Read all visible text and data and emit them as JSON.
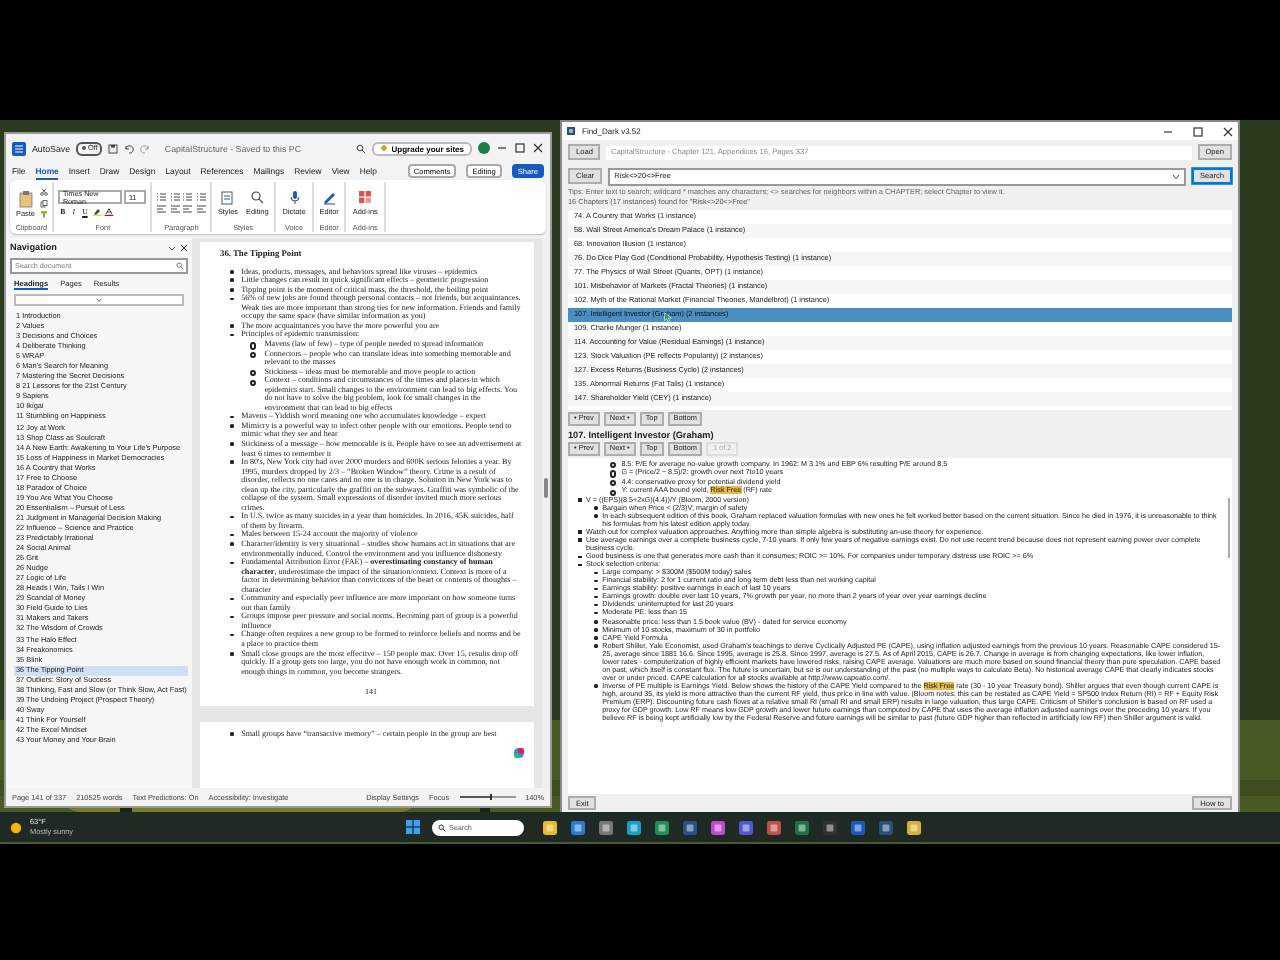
{
  "word": {
    "title": "CapitalStructure - Saved to this PC",
    "autosave": {
      "label": "AutoSave",
      "on": false,
      "state_text": "Off"
    },
    "upgrade": "Upgrade your sites",
    "menu_tabs": [
      {
        "label": "File",
        "selected": false
      },
      {
        "label": "Home",
        "selected": true
      },
      {
        "label": "Insert",
        "selected": false
      },
      {
        "label": "Draw",
        "selected": false
      },
      {
        "label": "Design",
        "selected": false
      },
      {
        "label": "Layout",
        "selected": false
      },
      {
        "label": "References",
        "selected": false
      },
      {
        "label": "Mailings",
        "selected": false
      },
      {
        "label": "Review",
        "selected": false
      },
      {
        "label": "View",
        "selected": false
      },
      {
        "label": "Help",
        "selected": false
      }
    ],
    "actions": [
      {
        "label": "Comments",
        "kind": "plain"
      },
      {
        "label": "Editing",
        "kind": "dropdown"
      },
      {
        "label": "Share",
        "kind": "primary"
      }
    ],
    "ribbon": [
      {
        "label": "Clipboard",
        "kind": "clipboard",
        "buttons": [
          "Paste"
        ]
      },
      {
        "label": "Font",
        "kind": "font",
        "font": "Times New Roman",
        "size": "11",
        "format": [
          "B",
          "I",
          "U"
        ]
      },
      {
        "label": "Paragraph",
        "kind": "paragraph"
      },
      {
        "label": "Styles",
        "kind": "big",
        "buttons": [
          "Styles",
          "Editing"
        ]
      },
      {
        "label": "Voice",
        "kind": "big",
        "buttons": [
          "Dictate"
        ]
      },
      {
        "label": "Editor",
        "kind": "big",
        "buttons": [
          "Editor"
        ]
      },
      {
        "label": "Add-ins",
        "kind": "big",
        "buttons": [
          "Add-ins"
        ]
      }
    ],
    "navigation": {
      "title": "Navigation",
      "placeholder": "Search document",
      "tabs": [
        {
          "label": "Headings",
          "selected": true
        },
        {
          "label": "Pages",
          "selected": false
        },
        {
          "label": "Results",
          "selected": false
        }
      ],
      "headings": [
        {
          "label": "1 Introduction",
          "selected": false
        },
        {
          "label": "2 Values",
          "selected": false
        },
        {
          "label": "3 Decisions and Choices",
          "selected": false
        },
        {
          "label": "4 Deliberate Thinking",
          "selected": false
        },
        {
          "label": "5 WRAP",
          "selected": false
        },
        {
          "label": "6 Man's Search for Meaning",
          "selected": false
        },
        {
          "label": "7 Mastering the Secret Decisions",
          "selected": false
        },
        {
          "label": "8 21 Lessons for the 21st Century",
          "selected": false
        },
        {
          "label": "9 Sapiens",
          "selected": false
        },
        {
          "label": "10 Ikigai",
          "selected": false
        },
        {
          "label": "11 Stumbling on Happiness",
          "selected": false
        },
        {
          "label": "12 Joy at Work",
          "selected": false
        },
        {
          "label": "13 Shop Class as Soulcraft",
          "selected": false
        },
        {
          "label": "14 A New Earth: Awakening to Your Life's Purpose",
          "selected": false
        },
        {
          "label": "15 Loss of Happiness in Market Democracies",
          "selected": false
        },
        {
          "label": "16 A Country that Works",
          "selected": false
        },
        {
          "label": "17 Free to Choose",
          "selected": false
        },
        {
          "label": "18 Paradox of Choice",
          "selected": false
        },
        {
          "label": "19 You Are What You Choose",
          "selected": false
        },
        {
          "label": "20 Essentialism – Pursuit of Less",
          "selected": false
        },
        {
          "label": "21 Judgment in Managerial Decision Making",
          "selected": false
        },
        {
          "label": "22 Influence – Science and Practice",
          "selected": false
        },
        {
          "label": "23 Predictably Irrational",
          "selected": false
        },
        {
          "label": "24 Social Animal",
          "selected": false
        },
        {
          "label": "25 Grit",
          "selected": false
        },
        {
          "label": "26 Nudge",
          "selected": false
        },
        {
          "label": "27 Logic of Life",
          "selected": false
        },
        {
          "label": "28 Heads I Win, Tails I Win",
          "selected": false
        },
        {
          "label": "29 Scandal of Money",
          "selected": false
        },
        {
          "label": "30 Field Guide to Lies",
          "selected": false
        },
        {
          "label": "31 Makers and Takers",
          "selected": false
        },
        {
          "label": "32 The Wisdom of Crowds",
          "selected": false
        },
        {
          "label": "33 The Halo Effect",
          "selected": false
        },
        {
          "label": "34 Freakonomics",
          "selected": false
        },
        {
          "label": "35 Blink",
          "selected": false
        },
        {
          "label": "36 The Tipping Point",
          "selected": true
        },
        {
          "label": "37 Outliers: Story of Success",
          "selected": false
        },
        {
          "label": "38 Thinking, Fast and Slow (or Think Slow, Act Fast)",
          "selected": false
        },
        {
          "label": "39 The Undoing Project (Prospect Theory)",
          "selected": false
        },
        {
          "label": "40 Sway",
          "selected": false
        },
        {
          "label": "41 Think For Yourself",
          "selected": false
        },
        {
          "label": "42 The Excel Mindset",
          "selected": false
        },
        {
          "label": "43 Your Money and Your Brain",
          "selected": false
        }
      ]
    },
    "document": {
      "heading": "36. The Tipping Point",
      "bullets": [
        {
          "text": "Ideas, products, messages, and behaviors spread like viruses – epidemics"
        },
        {
          "text": "Little changes can result in quick significant effects – geometric progression"
        },
        {
          "text": "Tipping point is the moment of critical mass, the threshold, the boiling point"
        },
        {
          "text": "56% of new jobs are found through personal contacts – not friends, but acquaintances.  Weak ties are more important than strong ties for new information.  Friends and family occupy the same space (have similar information as you)"
        },
        {
          "text": "The more acquaintances you have the more powerful you are"
        },
        {
          "text": "Principles of epidemic transmission:",
          "children": [
            {
              "text": "Mavens (law of few) – type of people needed to spread information"
            },
            {
              "text": "Connectors – people who can translate ideas into something memorable and relevant to the masses"
            },
            {
              "text": "Stickiness – ideas must be memorable and move people to action"
            },
            {
              "text": "Context – conditions and circumstances of the times and places in which epidemics start.  Small changes to the environment can lead to big effects.  You do not have to solve the big problem, look for small changes in the environment that can lead to big effects"
            }
          ]
        },
        {
          "text": "Mavens – Yiddish word meaning one who accumulates knowledge – expert"
        },
        {
          "text": "Mimicry is a powerful way to infect other people with our emotions.  People tend to mimic what they see and hear"
        },
        {
          "text": "Stickiness of a message – how memorable is it.  People have to see an advertisement at least 6 times to remember it"
        },
        {
          "text": "In 80's, New York city had over 2000 murders and 600K serious felonies a year.  By 1995, murders dropped by 2/3 – “Broken Window” theory.  Crime is a result of disorder, reflects no one cares and no one is in charge.  Solution in New York was to clean up the city, particularly the graffiti on the subways.  Graffiti was symbolic of the collapse of the system.  Small expressions of disorder invited much more serious crimes."
        },
        {
          "text": "In U.S. twice as many suicides in a year than homicides.  In 2016, 45K suicides, half of them by firearm."
        },
        {
          "text": "Males between 15-24 account the majority of violence"
        },
        {
          "text": "Character/identity is very situational – studies show humans act in situations that are environmentally induced.  Control the environment and you influence dishonesty"
        },
        {
          "text": "Fundamental Attribution Error (FAE) – **overestimating constancy of human character**, underestimate the impact of the situation/context.  Context is more of a factor in determining behavior than convictions of the heart or contents of thoughts – character"
        },
        {
          "text": "Community and especially peer influence are more important on how someone turns out than family"
        },
        {
          "text": "Groups impose peer pressure and social norms.  Becoming part of group is a powerful influence"
        },
        {
          "text": "Change often requires a new group to be formed to reinforce beliefs and norms and be a place to practice them"
        },
        {
          "text": "Small close groups are the most effective – 150 people max.  Over 15, results drop off quickly.  If a group gets too large, you do not have enough work in common, not enough things in common, you become strangers."
        }
      ],
      "page_number": "141",
      "next_page": [
        {
          "text": "Small groups have “transactive memory” – certain people in the group are best"
        }
      ]
    },
    "status_bar": [
      {
        "label": "Page 141 of 337",
        "kind": "text"
      },
      {
        "label": "210525 words",
        "kind": "text"
      },
      {
        "label": "Text Predictions: On",
        "kind": "text"
      },
      {
        "label": "Accessibility: Investigate",
        "kind": "text"
      },
      {
        "label": "Display Settings",
        "kind": "right"
      },
      {
        "label": "Focus",
        "kind": "right"
      },
      {
        "label": "140%",
        "kind": "zoom",
        "level": 0.55
      }
    ]
  },
  "find_dark": {
    "title": "Find_Dark v3.52",
    "load": "Load",
    "path": "CapitalStructure - Chapter 121, Appendices 16, Pages 337",
    "open": "Open",
    "clear": "Clear",
    "query": "Risk<>20<>Free",
    "search": "Search",
    "hint": "Tips: Enter text to search; wildcard * matches any characters; <> searches for neighbors within a CHAPTER; select Chapter to view it.",
    "count": "16 Chapters (17 instances) found for \"Risk<>20<>Free\"",
    "results": [
      {
        "label": "74. A Country that Works  (1 instance)",
        "selected": false
      },
      {
        "label": "58. Wall Street America's Dream Palace  (1 instance)",
        "selected": false
      },
      {
        "label": "68. Innovation Illusion  (1 instance)",
        "selected": false
      },
      {
        "label": "76. Do Dice Play God (Conditional Probability, Hypothesis Testing)  (1 instance)",
        "selected": false
      },
      {
        "label": "77. The Physics of Wall Street (Quants, OPT)  (1 instance)",
        "selected": false
      },
      {
        "label": "101. Misbehavior of Markets (Fractal Theories)  (1 instance)",
        "selected": false
      },
      {
        "label": "102. Myth of the Rational Market (Financial Theories, Mandelbrot)  (1 instance)",
        "selected": false
      },
      {
        "label": "107. Intelligent Investor (Graham)  (2 instances)",
        "selected": true
      },
      {
        "label": "109. Charlie Munger  (1 instance)",
        "selected": false
      },
      {
        "label": "114. Accounting for Value (Residual Earnings)  (1 instance)",
        "selected": false
      },
      {
        "label": "123. Stock Valuation (PE reflects Popularity)  (2 instances)",
        "selected": false
      },
      {
        "label": "127. Excess Returns (Business Cycle)  (2 instances)",
        "selected": false
      },
      {
        "label": "135. Abnormal Returns (Fat Tails)  (1 instance)",
        "selected": false
      },
      {
        "label": "147. Shareholder Yield (CEY)  (1 instance)",
        "selected": false
      }
    ],
    "nav_buttons": [
      "• Prev",
      "Next •",
      "Top",
      "Bottom"
    ],
    "chapter_title": "107.  Intelligent Investor (Graham)",
    "match_buttons": [
      {
        "label": "• Prev",
        "disabled": false
      },
      {
        "label": "Next •",
        "disabled": false
      },
      {
        "label": "Top",
        "disabled": false
      },
      {
        "label": "Bottom",
        "disabled": false
      },
      {
        "label": "1 of 2",
        "disabled": true
      }
    ],
    "detail": [
      {
        "children": [
          {
            "children": [
              {
                "text": "8.5: P/E for average no-value growth company. In 1962: M 3.1% and EBP 6% resulting P/E around 8.5"
              },
              {
                "text": "G = (Price/2 − 8.5)/2: growth over next 7to10 years"
              },
              {
                "text": "4.4: conservative proxy for potential dividend yield"
              },
              {
                "parts": [
                  {
                    "text": "Y: current AAA bound yield, "
                  },
                  {
                    "text": "Risk Free",
                    "highlight": true
                  },
                  {
                    "text": " (RF) rate"
                  }
                ]
              }
            ]
          }
        ]
      },
      {
        "text": "V = ((EPS)(8.5+2xG)(4.4))/Y  (Bloom, 2000 version)",
        "children": [
          {
            "text": "Bargain when Price < (2/3)V; margin of safety"
          },
          {
            "text": "In each subsequent edition of this book, Graham replaced valuation formulas with new ones he felt worked better based on the current situation. Since he died in 1976, it is unreasonable to think his formulas from his latest edition apply today."
          }
        ]
      },
      {
        "text": "Watch out for complex valuation approaches. Anything more than simple algebra is substituting an-use theory for experience."
      },
      {
        "text": "Use average earnings over a complete business cycle, 7-10 years. If only few years of negative earnings exist. Do not use recent trend because does not represent earning power over complete business cycle."
      },
      {
        "text": "Good business is one that generates more cash than it consumes; ROIC >= 10%. For companies under temporary distress use ROIC >= 6%"
      },
      {
        "text": "Stock selection criteria:",
        "children": [
          {
            "text": "Large company: > $300M ($500M today) sales"
          },
          {
            "text": "Financial stability: 2 for 1 current ratio and long term debt less than net working capital"
          },
          {
            "text": "Earnings stability: positive earnings in each of last 10 years"
          },
          {
            "text": "Earnings growth: double over last 10 years, 7% growth per year, no more than 2 years of year over year earnings decline"
          },
          {
            "text": "Dividends: uninterrupted for last 20 years"
          },
          {
            "text": "Moderate PE: less than 15"
          },
          {
            "text": "Reasonable price: less than 1.5 book value (BV) - dated for service economy"
          },
          {
            "text": "Minimum of 10 stocks, maximum of 30 in portfolio"
          },
          {
            "text": "CAPE Yield Formula"
          },
          {
            "text": "Robert Shiller, Yale Economist, used Graham's teachings to derive Cyclically Adjusted PE (CAPE), using inflation adjusted earnings from the previous 10 years. Reasonable CAPE considered 15-25, average since 1881 16.6. Since 1995, average is 25.8. Since 1997, average is 27.5. As of April 2015, CAPE is 26.7. Change in average is from changing expectations, like lower inflation, lower rates - computerization of highly efficient markets have lowered risks, raising CAPE average. Valuations are much more based on sound financial theory than pure speculation. CAPE based on past, which itself is constant flux. The future is uncertain, but so is our understanding of the past (no multiple ways to calculate Beta). No historical average CAPE that clearly indicates stocks over or under priced. CAPE calculation for all stocks available at http://www.capeatio.com/."
          },
          {
            "parts": [
              {
                "text": "Inverse of PE multiple is Earnings Yield. Below shows the history of the CAPE Yield compared to the "
              },
              {
                "text": "Risk Free",
                "highlight": true
              },
              {
                "text": " rate (30 - 10 year Treasury bond). Shiller argues that even though current CAPE is high, around 35, its yield is more attractive than the current RF yield, thus price in line with value. (Bloom notes: this can be restated as CAPE Yield = SP500 Index Return (RI) = RF + Equity Risk Premium (ERP). Discounting future cash flows at a relative small RI (small RI and small ERP) results in large valuation, thus large CAPE. Criticism of Shiller's conclusion is based on RF used a proxy for GDP growth. Low RF means low GDP growth and lower future earnings than computed by CAPE that uses the average inflation adjusted earnings over the preceding 10 years. If you believe RF is being kept artificially low by the Federal Reserve and future earnings will be similar to past (future GDP higher than reflected in artificially low RF) then Shiller argument is valid."
              }
            ]
          }
        ]
      }
    ],
    "exit": "Exit",
    "help": "How to"
  },
  "taskbar": {
    "weather": {
      "temp": "63°F",
      "condition": "Mostly sunny"
    },
    "search_placeholder": "Search"
  }
}
